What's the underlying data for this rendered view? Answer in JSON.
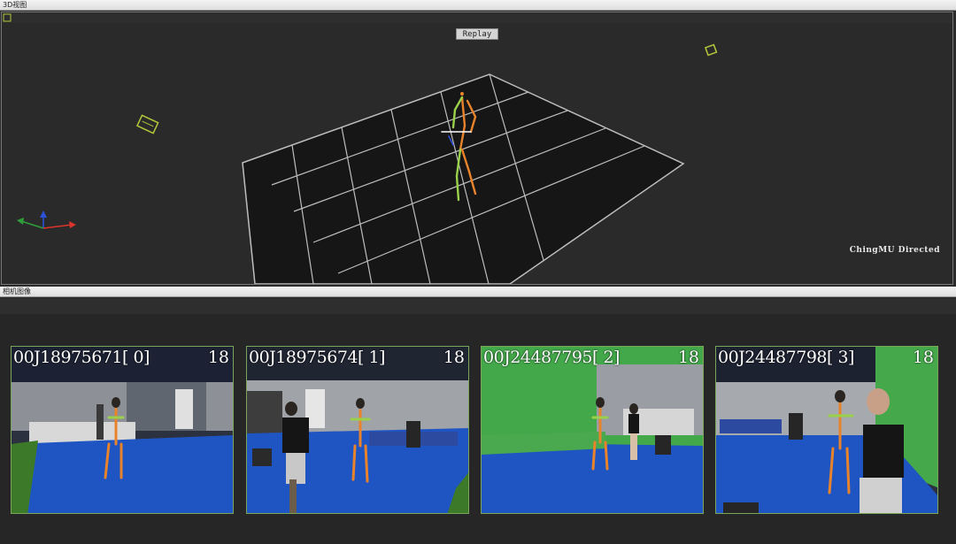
{
  "view3d": {
    "title": "3D视图",
    "replay_label": "Replay",
    "credit": "ChingMU Directed"
  },
  "camera_panel": {
    "title": "相机图像",
    "cameras": [
      {
        "label": "00J18975671[ 0]",
        "frame": "18"
      },
      {
        "label": "00J18975674[ 1]",
        "frame": "18"
      },
      {
        "label": "00J24487795[ 2]",
        "frame": "18"
      },
      {
        "label": "00J24487798[ 3]",
        "frame": "18"
      }
    ]
  },
  "colors": {
    "grid_line": "#bdbdbd",
    "floor": "#161616",
    "axis_x": "#d9352b",
    "axis_y": "#2f9e3a",
    "axis_z": "#2b52d6",
    "camera_marker": "#b7c83a",
    "skeleton_left": "#e8832c",
    "skeleton_right": "#9ad14a"
  }
}
